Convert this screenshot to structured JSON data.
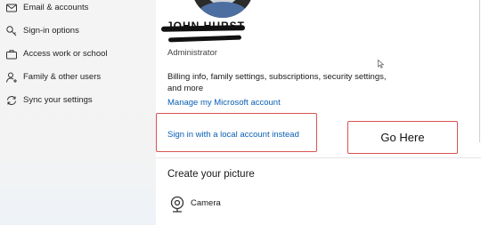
{
  "sidebar": {
    "items": [
      {
        "label": "Email & accounts",
        "icon": "mail-icon"
      },
      {
        "label": "Sign-in options",
        "icon": "key-icon"
      },
      {
        "label": "Access work or school",
        "icon": "briefcase-icon"
      },
      {
        "label": "Family & other users",
        "icon": "person-add-icon"
      },
      {
        "label": "Sync your settings",
        "icon": "sync-icon"
      }
    ]
  },
  "profile": {
    "name": "JOHN HURST",
    "role": "Administrator",
    "description": "Billing info, family settings, subscriptions, security settings, and more",
    "manage_link": "Manage my Microsoft account",
    "signin_local_link": "Sign in with a local account instead"
  },
  "annotation": {
    "go_here": "Go Here",
    "color": "#d9534f"
  },
  "picture": {
    "title": "Create your picture",
    "camera_label": "Camera"
  },
  "colors": {
    "link": "#0a5fb4",
    "sidebar_bg": "#f3f3f3"
  }
}
